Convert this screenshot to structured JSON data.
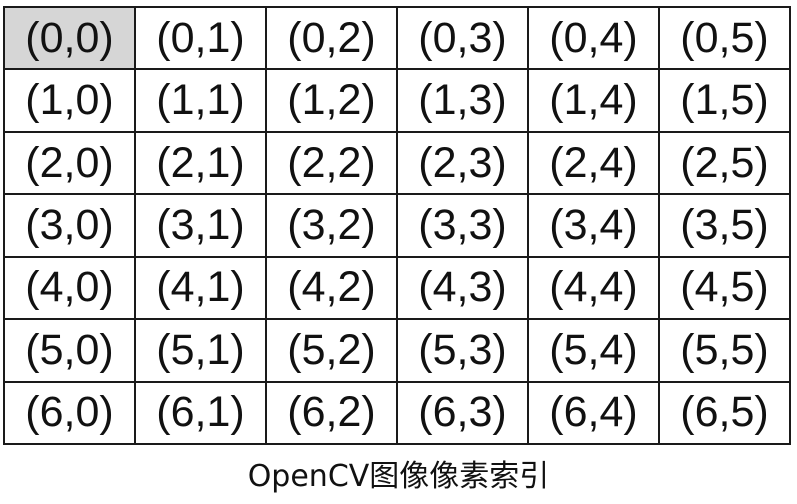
{
  "grid": {
    "rows": [
      [
        "(0,0)",
        "(0,1)",
        "(0,2)",
        "(0,3)",
        "(0,4)",
        "(0,5)"
      ],
      [
        "(1,0)",
        "(1,1)",
        "(1,2)",
        "(1,3)",
        "(1,4)",
        "(1,5)"
      ],
      [
        "(2,0)",
        "(2,1)",
        "(2,2)",
        "(2,3)",
        "(2,4)",
        "(2,5)"
      ],
      [
        "(3,0)",
        "(3,1)",
        "(3,2)",
        "(3,3)",
        "(3,4)",
        "(3,5)"
      ],
      [
        "(4,0)",
        "(4,1)",
        "(4,2)",
        "(4,3)",
        "(4,4)",
        "(4,5)"
      ],
      [
        "(5,0)",
        "(5,1)",
        "(5,2)",
        "(5,3)",
        "(5,4)",
        "(5,5)"
      ],
      [
        "(6,0)",
        "(6,1)",
        "(6,2)",
        "(6,3)",
        "(6,4)",
        "(6,5)"
      ]
    ],
    "highlight_color": "#d6d6d6",
    "border_color": "#1a1a1a"
  },
  "caption": "OpenCV图像像素索引"
}
